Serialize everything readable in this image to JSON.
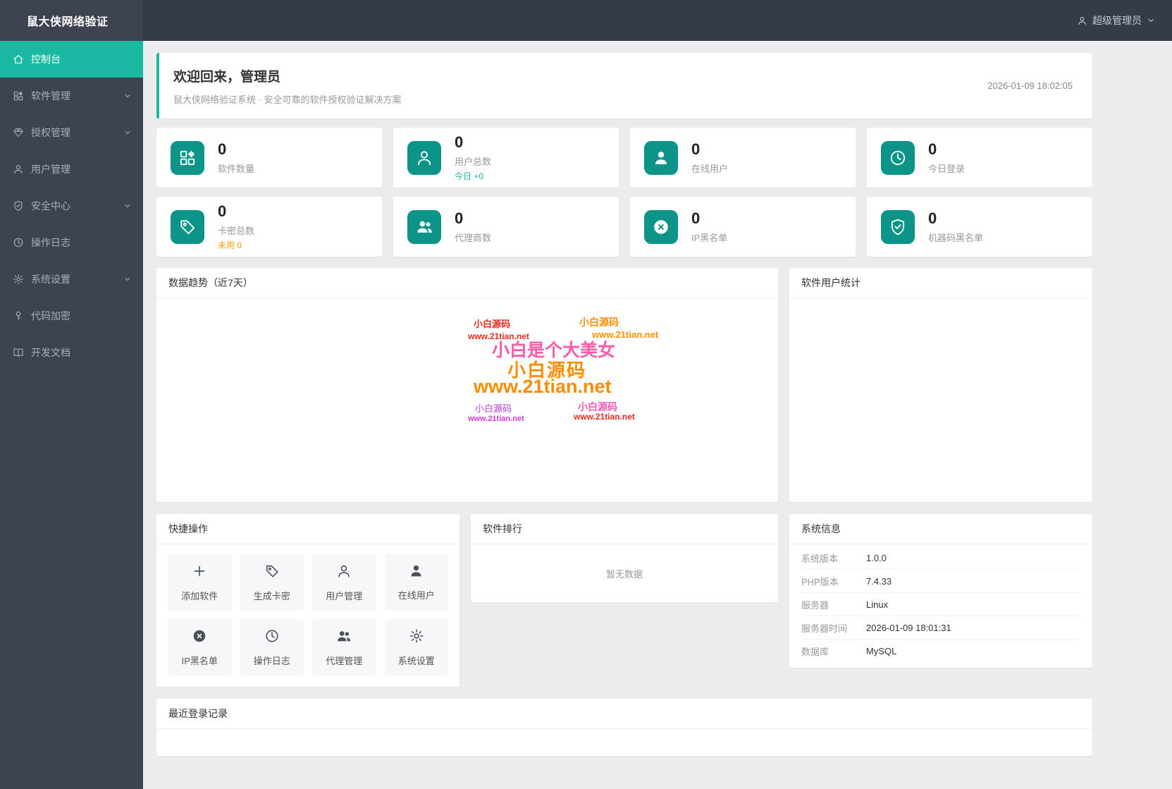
{
  "colors": {
    "teal_accent": "#19b9a4",
    "teal_tile": "#0d9488",
    "warn_orange": "#f59e0b",
    "dark_bg": "#3d4350"
  },
  "app": {
    "title": "鼠大侠网络验证"
  },
  "topbar": {
    "user_label": "超级管理员"
  },
  "sidebar": {
    "items": [
      {
        "label": "控制台",
        "icon": "home-icon",
        "active": true,
        "chevron": false
      },
      {
        "label": "软件管理",
        "icon": "grid-icon",
        "active": false,
        "chevron": true
      },
      {
        "label": "授权管理",
        "icon": "gem-icon",
        "active": false,
        "chevron": true
      },
      {
        "label": "用户管理",
        "icon": "user-icon",
        "active": false,
        "chevron": false
      },
      {
        "label": "安全中心",
        "icon": "shield-icon",
        "active": false,
        "chevron": true
      },
      {
        "label": "操作日志",
        "icon": "clock-icon",
        "active": false,
        "chevron": false
      },
      {
        "label": "系统设置",
        "icon": "gear-icon",
        "active": false,
        "chevron": true
      },
      {
        "label": "代码加密",
        "icon": "key-icon",
        "active": false,
        "chevron": false
      },
      {
        "label": "开发文档",
        "icon": "book-icon",
        "active": false,
        "chevron": false
      }
    ]
  },
  "welcome": {
    "title": "欢迎回来，管理员",
    "subtitle": "鼠大侠网络验证系统 · 安全可靠的软件授权验证解决方案",
    "timestamp": "2026-01-09 18:02:05"
  },
  "stats": [
    {
      "value": "0",
      "label": "软件数量",
      "icon": "grid-icon"
    },
    {
      "value": "0",
      "label": "用户总数",
      "icon": "user-outline-icon",
      "extra": "今日 +0"
    },
    {
      "value": "0",
      "label": "在线用户",
      "icon": "user-filled-icon"
    },
    {
      "value": "0",
      "label": "今日登录",
      "icon": "clock-icon"
    },
    {
      "value": "0",
      "label": "卡密总数",
      "icon": "tag-icon",
      "extra": "未用 0"
    },
    {
      "value": "0",
      "label": "代理商数",
      "icon": "users-icon"
    },
    {
      "value": "0",
      "label": "IP黑名单",
      "icon": "x-circle-icon"
    },
    {
      "value": "0",
      "label": "机器码黑名单",
      "icon": "shield-check-icon"
    }
  ],
  "trend_panel": {
    "title": "数据趋势（近7天）"
  },
  "software_users_panel": {
    "title": "软件用户统计"
  },
  "watermarks": [
    {
      "text": "小白源码",
      "color": "#e8291c"
    },
    {
      "text": "www.21tian.net",
      "color": "#e8291c"
    },
    {
      "text": "小白源码",
      "color": "#ff9100"
    },
    {
      "text": "www.21tian.net",
      "color": "#ff9100"
    },
    {
      "text": "小白是个大美女",
      "color": "#ff5ca8"
    },
    {
      "text": "小白源码",
      "color": "#ff8c00"
    },
    {
      "text": "www.21tian.net",
      "color": "#ff8c00"
    },
    {
      "text": "小白源码",
      "color": "#c77fe0"
    },
    {
      "text": "www.21tian.net",
      "color": "#d43bd0"
    },
    {
      "text": "小白源码",
      "color": "#ff59b0"
    },
    {
      "text": "www.21tian.net",
      "color": "#e8291c"
    }
  ],
  "quick_actions": {
    "title": "快捷操作",
    "items": [
      {
        "label": "添加软件",
        "icon": "plus-icon"
      },
      {
        "label": "生成卡密",
        "icon": "tag-icon"
      },
      {
        "label": "用户管理",
        "icon": "user-outline-icon"
      },
      {
        "label": "在线用户",
        "icon": "user-filled-icon"
      },
      {
        "label": "IP黑名单",
        "icon": "x-circle-icon"
      },
      {
        "label": "操作日志",
        "icon": "clock-icon"
      },
      {
        "label": "代理管理",
        "icon": "users-icon"
      },
      {
        "label": "系统设置",
        "icon": "gear-icon"
      }
    ]
  },
  "ranking_panel": {
    "title": "软件排行",
    "empty_text": "暂无数据"
  },
  "system_info": {
    "title": "系统信息",
    "rows": [
      {
        "label": "系统版本",
        "value": "1.0.0"
      },
      {
        "label": "PHP版本",
        "value": "7.4.33"
      },
      {
        "label": "服务器",
        "value": "Linux"
      },
      {
        "label": "服务器时间",
        "value": "2026-01-09 18:01:31"
      },
      {
        "label": "数据库",
        "value": "MySQL"
      }
    ]
  },
  "recent_panel": {
    "title": "最近登录记录"
  }
}
